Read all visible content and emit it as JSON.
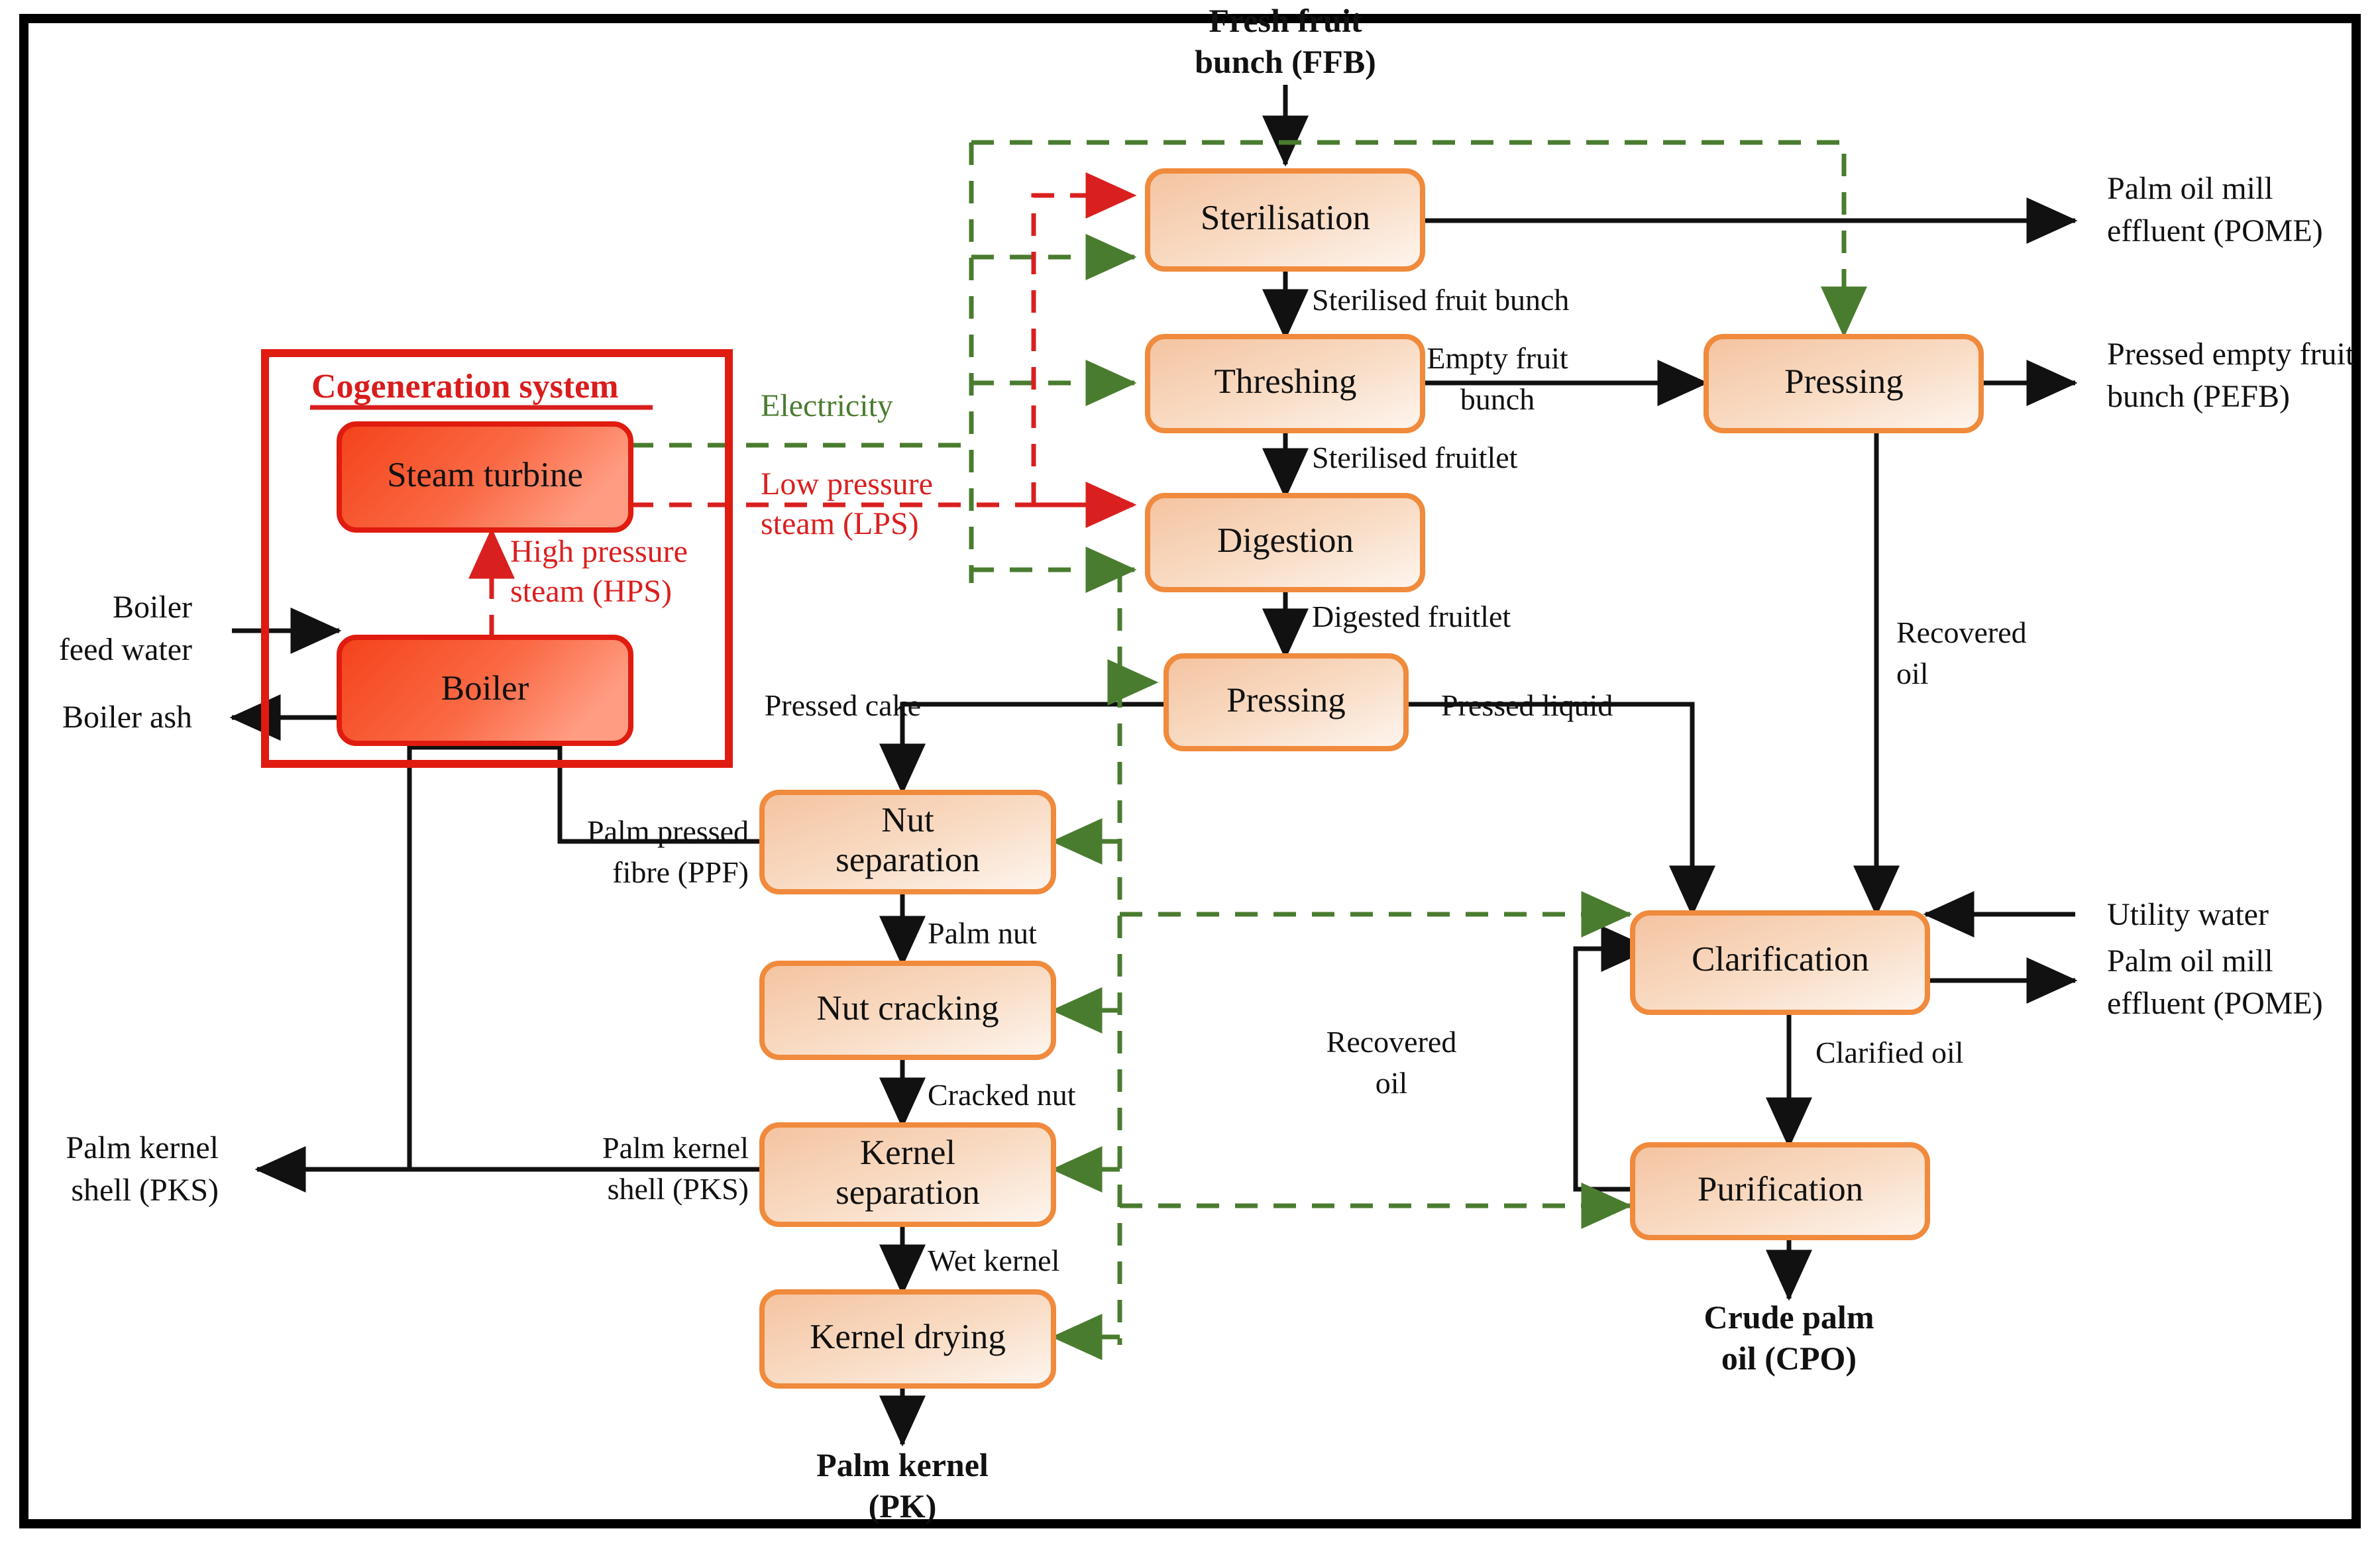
{
  "figure": {
    "kind": "process-flow-diagram",
    "subject": "Palm oil milling process with cogeneration system"
  },
  "colors": {
    "process_fill_dark": "#f6c9a6",
    "process_fill_light": "#fdf5ee",
    "process_stroke": "#f08a3c",
    "cogen_fill_dark": "#f4421a",
    "cogen_fill_light": "#ff9b80",
    "cogen_stroke": "#e01b0f",
    "electricity_green": "#4a7c2f",
    "steam_red": "#d9201f",
    "flow_black": "#111111",
    "frame_black": "#000000"
  },
  "cogeneration": {
    "title": "Cogeneration system",
    "boxes": [
      {
        "id": "steam-turbine",
        "label": "Steam turbine"
      },
      {
        "id": "boiler",
        "label": "Boiler"
      }
    ],
    "internal_stream": "High pressure\nsteam (HPS)",
    "internal_stream_line1": "High pressure",
    "internal_stream_line2": "steam (HPS)"
  },
  "utility_streams": {
    "electricity": "Electricity",
    "lps_line1": "Low pressure",
    "lps_line2": "steam (LPS)"
  },
  "process_boxes": [
    {
      "id": "sterilisation",
      "label": "Sterilisation"
    },
    {
      "id": "threshing",
      "label": "Threshing"
    },
    {
      "id": "digestion",
      "label": "Digestion"
    },
    {
      "id": "pressing-main",
      "label": "Pressing"
    },
    {
      "id": "pressing-efb",
      "label": "Pressing"
    },
    {
      "id": "nut-separation-l1",
      "label": "Nut"
    },
    {
      "id": "nut-separation-l2",
      "label": "separation"
    },
    {
      "id": "nut-cracking",
      "label": "Nut cracking"
    },
    {
      "id": "kernel-separation-l1",
      "label": "Kernel"
    },
    {
      "id": "kernel-separation-l2",
      "label": "separation"
    },
    {
      "id": "kernel-drying",
      "label": "Kernel drying"
    },
    {
      "id": "clarification",
      "label": "Clarification"
    },
    {
      "id": "purification",
      "label": "Purification"
    }
  ],
  "inputs": [
    {
      "id": "ffb",
      "line1": "Fresh fruit",
      "line2": "bunch (FFB)"
    },
    {
      "id": "boiler-feed-water",
      "line1": "Boiler",
      "line2": "feed water"
    },
    {
      "id": "utility-water",
      "line1": "Utility water",
      "line2": ""
    }
  ],
  "outputs": [
    {
      "id": "pome-top",
      "line1": "Palm oil mill",
      "line2": "effluent (POME)"
    },
    {
      "id": "pefb",
      "line1": "Pressed empty fruit",
      "line2": "bunch (PEFB)"
    },
    {
      "id": "pome-bottom",
      "line1": "Palm oil mill",
      "line2": "effluent (POME)"
    },
    {
      "id": "boiler-ash",
      "line1": "Boiler ash",
      "line2": ""
    },
    {
      "id": "pks-out",
      "line1": "Palm kernel",
      "line2": "shell (PKS)"
    },
    {
      "id": "cpo",
      "line1": "Crude palm",
      "line2": "oil (CPO)"
    },
    {
      "id": "pk",
      "line1": "Palm kernel",
      "line2": "(PK)"
    }
  ],
  "stream_labels": {
    "sterilised_fruit_bunch": "Sterilised fruit bunch",
    "empty_fruit_bunch_l1": "Empty fruit",
    "empty_fruit_bunch_l2": "bunch",
    "sterilised_fruitlet": "Sterilised fruitlet",
    "digested_fruitlet": "Digested fruitlet",
    "pressed_cake": "Pressed cake",
    "pressed_liquid": "Pressed liquid",
    "recovered_oil_top_l1": "Recovered",
    "recovered_oil_top_l2": "oil",
    "recovered_oil_mid_l1": "Recovered",
    "recovered_oil_mid_l2": "oil",
    "palm_pressed_fibre_l1": "Palm pressed",
    "palm_pressed_fibre_l2": "fibre (PPF)",
    "palm_nut": "Palm nut",
    "cracked_nut": "Cracked nut",
    "palm_kernel_shell_l1": "Palm kernel",
    "palm_kernel_shell_l2": "shell (PKS)",
    "wet_kernel": "Wet kernel",
    "clarified_oil": "Clarified oil"
  },
  "legend_semantics": {
    "solid_black": "material stream",
    "dashed_green": "electricity",
    "dashed_red": "steam"
  }
}
